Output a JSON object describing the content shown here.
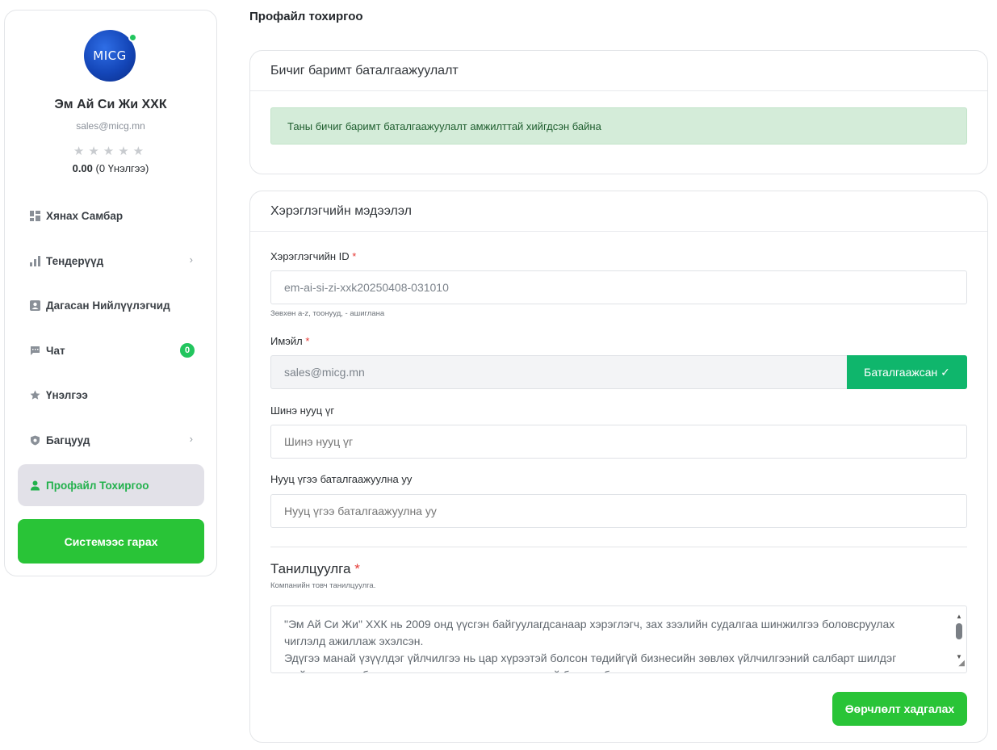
{
  "sidebar": {
    "logo_text": "MICG",
    "company_name": "Эм Ай Си Жи ХХК",
    "company_email": "sales@micg.mn",
    "stars": "★★★★★",
    "rating_value": "0.00",
    "rating_count": "(0 Үнэлгээ)",
    "items": [
      {
        "label": "Хянах Самбар",
        "icon": "dashboard-icon"
      },
      {
        "label": "Тендерүүд",
        "icon": "bar-chart-icon",
        "chevron": "›"
      },
      {
        "label": "Дагасан Нийлүүлэгчид",
        "icon": "contact-card-icon"
      },
      {
        "label": "Чат",
        "icon": "chat-icon",
        "badge": "0"
      },
      {
        "label": "Үнэлгээ",
        "icon": "star-icon"
      },
      {
        "label": "Багцууд",
        "icon": "shield-icon",
        "chevron": "›"
      },
      {
        "label": "Профайл Тохиргоо",
        "icon": "user-icon"
      }
    ],
    "logout_label": "Системээс гарах"
  },
  "main": {
    "page_title": "Профайл тохиргоо",
    "verification_card": {
      "title": "Бичиг баримт баталгаажуулалт",
      "alert": "Таны бичиг баримт баталгаажуулалт амжилттай хийгдсэн байна"
    },
    "user_card": {
      "title": "Хэрэглэгчийн мэдээлэл",
      "user_id_label": "Хэрэглэгчийн ID",
      "required_mark": "*",
      "user_id_value": "em-ai-si-zi-xxk20250408-031010",
      "user_id_hint": "Зөвхөн a-z, тоонууд, - ашиглана",
      "email_label": "Имэйл",
      "email_value": "sales@micg.mn",
      "verified_label": "Баталгаажсан ✓",
      "new_password_label": "Шинэ нууц үг",
      "new_password_placeholder": "Шинэ нууц үг",
      "confirm_password_label": "Нууц үгээ баталгаажуулна уу",
      "confirm_password_placeholder": "Нууц үгээ баталгаажуулна уу",
      "intro_title": "Танилцуулга",
      "intro_hint": "Компанийн товч танилцуулга.",
      "intro_text_1": "\"Эм Ай Си Жи\" ХХК нь 2009 онд үүсгэн байгуулагдсанаар хэрэглэгч, зах зээлийн судалгаа шинжилгээ боловсруулах чиглэлд ажиллаж эхэлсэн.",
      "intro_text_2": "Эдүгээ манай үзүүлдэг үйлчилгээ нь цар хүрээтэй болсон төдийгүй бизнесийн зөвлөх үйлчилгээний салбарт шилдэг шийдэл санал болгон ажиллах цаашид туршлагатай болсон билээ.",
      "save_label": "Өөрчлөлт хадгалах"
    }
  }
}
